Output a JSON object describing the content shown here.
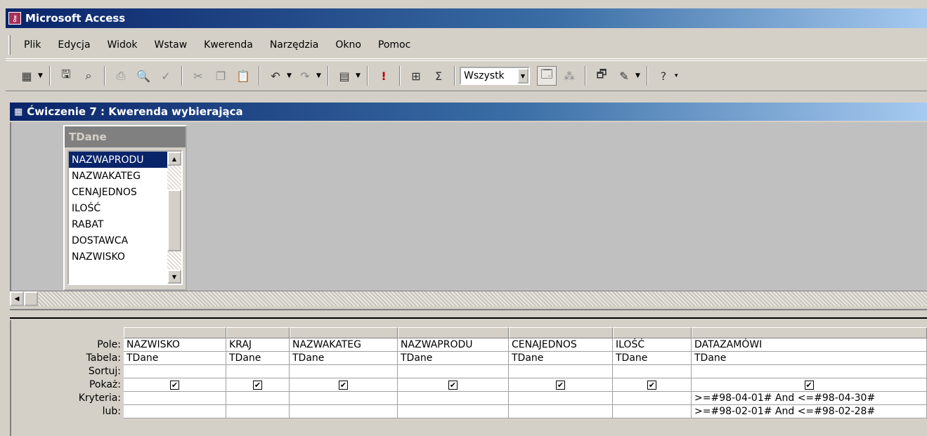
{
  "app": {
    "title": "Microsoft Access"
  },
  "menu": {
    "items": [
      {
        "label": "Plik"
      },
      {
        "label": "Edycja"
      },
      {
        "label": "Widok"
      },
      {
        "label": "Wstaw"
      },
      {
        "label": "Kwerenda"
      },
      {
        "label": "Narzędzia"
      },
      {
        "label": "Okno"
      },
      {
        "label": "Pomoc"
      }
    ]
  },
  "toolbar": {
    "combo_value": "Wszystk"
  },
  "document": {
    "title": "Ćwiczenie 7 : Kwerenda wybierająca"
  },
  "table": {
    "name": "TDane",
    "fields": [
      "NAZWAPRODU",
      "NAZWAKATEG",
      "CENAJEDNOS",
      "ILOŚĆ",
      "RABAT",
      "DOSTAWCA",
      "NAZWISKO"
    ],
    "selected": "NAZWAPRODU"
  },
  "grid": {
    "row_labels": [
      "Pole:",
      "Tabela:",
      "Sortuj:",
      "Pokaż:",
      "Kryteria:",
      "lub:"
    ],
    "columns": [
      {
        "field": "NAZWISKO",
        "table": "TDane",
        "sort": "",
        "show": true,
        "criteria": "",
        "or": ""
      },
      {
        "field": "KRAJ",
        "table": "TDane",
        "sort": "",
        "show": true,
        "criteria": "",
        "or": ""
      },
      {
        "field": "NAZWAKATEG",
        "table": "TDane",
        "sort": "",
        "show": true,
        "criteria": "",
        "or": ""
      },
      {
        "field": "NAZWAPRODU",
        "table": "TDane",
        "sort": "",
        "show": true,
        "criteria": "",
        "or": ""
      },
      {
        "field": "CENAJEDNOS",
        "table": "TDane",
        "sort": "",
        "show": true,
        "criteria": "",
        "or": ""
      },
      {
        "field": "ILOŚĆ",
        "table": "TDane",
        "sort": "",
        "show": true,
        "criteria": "",
        "or": ""
      },
      {
        "field": "DATAZAMÓWI",
        "table": "TDane",
        "sort": "",
        "show": true,
        "criteria": ">=#98-04-01# And <=#98-04-30#",
        "or": ">=#98-02-01# And <=#98-02-28#"
      }
    ]
  }
}
